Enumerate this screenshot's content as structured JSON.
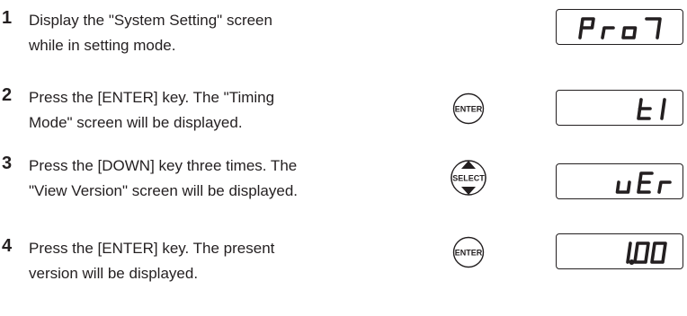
{
  "steps": [
    {
      "number": "1",
      "line1": "Display the \"System Setting\" screen",
      "line2": "while in setting mode.",
      "key": null,
      "display": "Pro7"
    },
    {
      "number": "2",
      "line1": "Press the [ENTER] key. The \"Timing",
      "line2": "Mode\" screen will be displayed.",
      "key": "ENTER",
      "display": "t1"
    },
    {
      "number": "3",
      "line1": "Press the [DOWN] key three times. The",
      "line2": "\"View Version\" screen will be displayed.",
      "key": "SELECT",
      "display": "uEr"
    },
    {
      "number": "4",
      "line1": "Press the [ENTER] key. The present",
      "line2": "version will be displayed.",
      "key": "ENTER",
      "display": "1.00"
    }
  ]
}
